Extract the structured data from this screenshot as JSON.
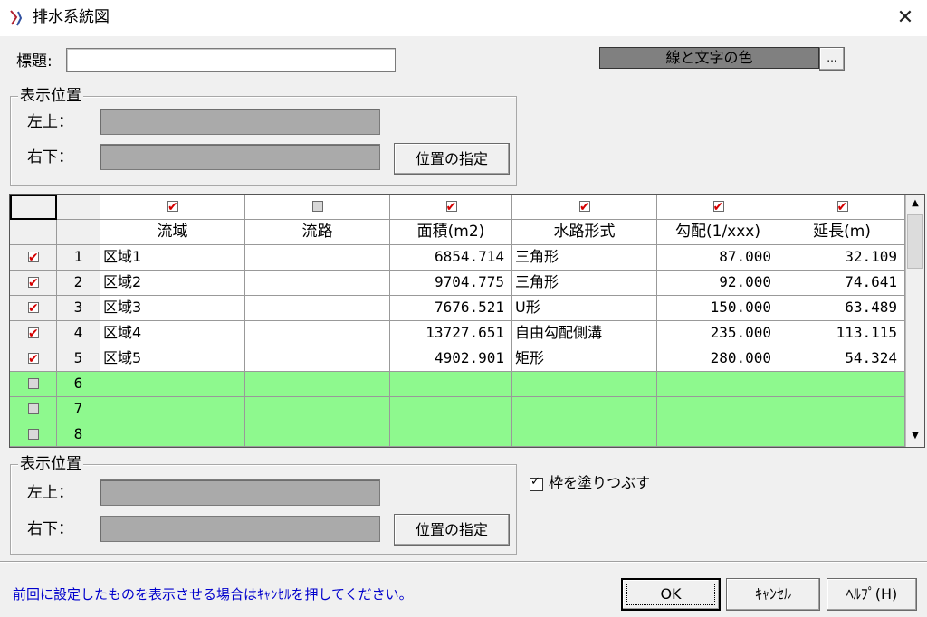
{
  "window": {
    "title": "排水系統図",
    "close": "✕"
  },
  "title_label": "標題:",
  "title_value": "",
  "color_button": {
    "label": "線と文字の色",
    "more": "..."
  },
  "top_position": {
    "legend": "表示位置",
    "upper_left_label": "左上：",
    "lower_right_label": "右下：",
    "button": "位置の指定"
  },
  "grid": {
    "columns": [
      "流域",
      "流路",
      "面積(m2)",
      "水路形式",
      "勾配(1/xxx)",
      "延長(m)"
    ],
    "column_checks": [
      true,
      false,
      true,
      true,
      true,
      true
    ],
    "rows": [
      {
        "no": "1",
        "checked": true,
        "cells": [
          "区域1",
          "",
          "6854.714",
          "三角形",
          "87.000",
          "32.109"
        ]
      },
      {
        "no": "2",
        "checked": true,
        "cells": [
          "区域2",
          "",
          "9704.775",
          "三角形",
          "92.000",
          "74.641"
        ]
      },
      {
        "no": "3",
        "checked": true,
        "cells": [
          "区域3",
          "",
          "7676.521",
          "U形",
          "150.000",
          "63.489"
        ]
      },
      {
        "no": "4",
        "checked": true,
        "cells": [
          "区域4",
          "",
          "13727.651",
          "自由勾配側溝",
          "235.000",
          "113.115"
        ]
      },
      {
        "no": "5",
        "checked": true,
        "cells": [
          "区域5",
          "",
          "4902.901",
          "矩形",
          "280.000",
          "54.324"
        ]
      },
      {
        "no": "6",
        "checked": false,
        "cells": [
          "",
          "",
          "",
          "",
          "",
          ""
        ]
      },
      {
        "no": "7",
        "checked": false,
        "cells": [
          "",
          "",
          "",
          "",
          "",
          ""
        ]
      },
      {
        "no": "8",
        "checked": false,
        "cells": [
          "",
          "",
          "",
          "",
          "",
          ""
        ]
      }
    ]
  },
  "bottom_position": {
    "legend": "表示位置",
    "upper_left_label": "左上：",
    "lower_right_label": "右下：",
    "button": "位置の指定"
  },
  "fill_frame": {
    "label": "枠を塗りつぶす",
    "checked": true
  },
  "hint": "前回に設定したものを表示させる場合はｷｬﾝｾﾙを押してください。",
  "buttons": {
    "ok": "OK",
    "cancel": "ｷｬﾝｾﾙ",
    "help": "ﾍﾙﾌﾟ(H)"
  }
}
